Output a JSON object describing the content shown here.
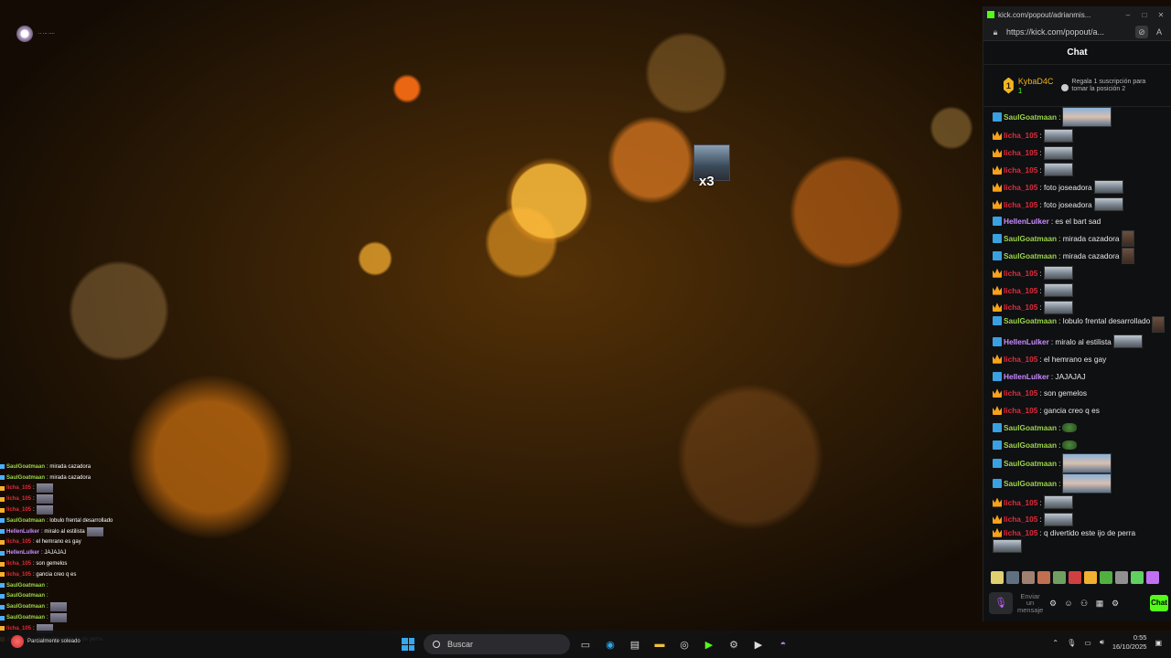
{
  "stream": {
    "label": "·· ··· ····"
  },
  "overlay": {
    "emote_count": "x3"
  },
  "overlay_chat": [
    {
      "name": "SaulGoatmaan",
      "text": ": mirada cazadora",
      "badge": "blue"
    },
    {
      "name": "SaulGoatmaan",
      "text": ": mirada cazadora",
      "badge": "blue"
    },
    {
      "name": "licha_105",
      "text": ":",
      "badge": "crown",
      "emote": true
    },
    {
      "name": "licha_105",
      "text": ":",
      "badge": "crown",
      "emote": true
    },
    {
      "name": "licha_105",
      "text": ":",
      "badge": "crown",
      "emote": true
    },
    {
      "name": "SaulGoatmaan",
      "text": ": lobulo frental desarrollado",
      "badge": "blue"
    },
    {
      "name": "HellenLulker",
      "text": ": miralo al estilista",
      "badge": "blue",
      "emote": true
    },
    {
      "name": "licha_105",
      "text": ": el hemrano es gay",
      "badge": "crown"
    },
    {
      "name": "HellenLulker",
      "text": ": JAJAJAJ",
      "badge": "blue"
    },
    {
      "name": "licha_105",
      "text": ": son gemelos",
      "badge": "crown"
    },
    {
      "name": "licha_105",
      "text": ": gancia creo q es",
      "badge": "crown"
    },
    {
      "name": "SaulGoatmaan",
      "text": ":",
      "badge": "blue"
    },
    {
      "name": "SaulGoatmaan",
      "text": ":",
      "badge": "blue"
    },
    {
      "name": "SaulGoatmaan",
      "text": ":",
      "badge": "blue",
      "emote": true
    },
    {
      "name": "SaulGoatmaan",
      "text": ":",
      "badge": "blue",
      "emote": true
    },
    {
      "name": "licha_105",
      "text": ":",
      "badge": "crown",
      "emote": true
    },
    {
      "name": "licha_105",
      "text": ": q divertido este ijo de perra",
      "badge": "crown"
    }
  ],
  "window": {
    "title": "kick.com/popout/adrianmis...",
    "url": "https://kick.com/popout/a...",
    "hide_icon": "eye-off-icon",
    "read_icon": "A",
    "minimize": "–",
    "maximize": "□",
    "close": "✕"
  },
  "chat": {
    "header": "Chat",
    "top_gifter": {
      "rank": "1",
      "name": "KybaD4C",
      "count": "1",
      "note": "Regala 1 suscripción para tomar la posición 2"
    },
    "colors": {
      "crown_user": "#e02a3a",
      "saul": "#9bd34a",
      "hellen": "#c98cff",
      "kick_green": "#53fc18"
    },
    "messages": [
      {
        "user": "SaulGoatmaan",
        "color": "#9bd34a",
        "badge": "sword",
        "text": ":",
        "emote": "wide"
      },
      {
        "user": "licha_105",
        "color": "#e02a3a",
        "badge": "crown",
        "text": ":",
        "emote": "normal"
      },
      {
        "user": "licha_105",
        "color": "#e02a3a",
        "badge": "crown",
        "text": ":",
        "emote": "normal"
      },
      {
        "user": "licha_105",
        "color": "#e02a3a",
        "badge": "crown",
        "text": ":",
        "emote": "normal"
      },
      {
        "user": "licha_105",
        "color": "#e02a3a",
        "badge": "crown",
        "text": ": foto joseadora",
        "emote": "normal"
      },
      {
        "user": "licha_105",
        "color": "#e02a3a",
        "badge": "crown",
        "text": ": foto joseadora",
        "emote": "normal"
      },
      {
        "user": "HellenLulker",
        "color": "#c98cff",
        "badge": "sword",
        "text": ": es el bart sad",
        "emote": ""
      },
      {
        "user": "SaulGoatmaan",
        "color": "#9bd34a",
        "badge": "sword",
        "text": ": mirada cazadora",
        "emote": "face"
      },
      {
        "user": "SaulGoatmaan",
        "color": "#9bd34a",
        "badge": "sword",
        "text": ": mirada cazadora",
        "emote": "face"
      },
      {
        "user": "licha_105",
        "color": "#e02a3a",
        "badge": "crown",
        "text": ":",
        "emote": "normal"
      },
      {
        "user": "licha_105",
        "color": "#e02a3a",
        "badge": "crown",
        "text": ":",
        "emote": "normal"
      },
      {
        "user": "licha_105",
        "color": "#e02a3a",
        "badge": "crown",
        "text": ":",
        "emote": "normal"
      },
      {
        "user": "SaulGoatmaan",
        "color": "#9bd34a",
        "badge": "sword",
        "text": ": lobulo frental desarrollado",
        "emote": "face"
      },
      {
        "user": "HellenLulker",
        "color": "#c98cff",
        "badge": "sword",
        "text": ": miralo al estilista",
        "emote": "normal"
      },
      {
        "user": "licha_105",
        "color": "#e02a3a",
        "badge": "crown",
        "text": ": el hemrano es gay",
        "emote": ""
      },
      {
        "user": "HellenLulker",
        "color": "#c98cff",
        "badge": "sword",
        "text": ": JAJAJAJ",
        "emote": ""
      },
      {
        "user": "licha_105",
        "color": "#e02a3a",
        "badge": "crown",
        "text": ": son gemelos",
        "emote": ""
      },
      {
        "user": "licha_105",
        "color": "#e02a3a",
        "badge": "crown",
        "text": ": gancia creo q es",
        "emote": ""
      },
      {
        "user": "SaulGoatmaan",
        "color": "#9bd34a",
        "badge": "sword",
        "text": ":",
        "emote": "small"
      },
      {
        "user": "SaulGoatmaan",
        "color": "#9bd34a",
        "badge": "sword",
        "text": ":",
        "emote": "small"
      },
      {
        "user": "SaulGoatmaan",
        "color": "#9bd34a",
        "badge": "sword",
        "text": ":",
        "emote": "wide"
      },
      {
        "user": "SaulGoatmaan",
        "color": "#9bd34a",
        "badge": "sword",
        "text": ":",
        "emote": "wide"
      },
      {
        "user": "licha_105",
        "color": "#e02a3a",
        "badge": "crown",
        "text": ":",
        "emote": "normal"
      },
      {
        "user": "licha_105",
        "color": "#e02a3a",
        "badge": "crown",
        "text": ":",
        "emote": "normal"
      },
      {
        "user": "licha_105",
        "color": "#e02a3a",
        "badge": "crown",
        "text": ": q divertido este ijo de perra",
        "emote": "normal"
      }
    ],
    "emote_bar": [
      "#e0d070",
      "#607080",
      "#a08070",
      "#c07050",
      "#70a060",
      "#d04040",
      "#f0b030",
      "#50b040",
      "#909090",
      "#60d060",
      "#c070f0"
    ],
    "composer": {
      "placeholder": "Enviar un mensaje",
      "send_label": "Chat"
    }
  },
  "taskbar": {
    "search_placeholder": "Buscar",
    "time": "0:55",
    "date": "16/10/2025",
    "weather": "Parcialmente soleado"
  }
}
